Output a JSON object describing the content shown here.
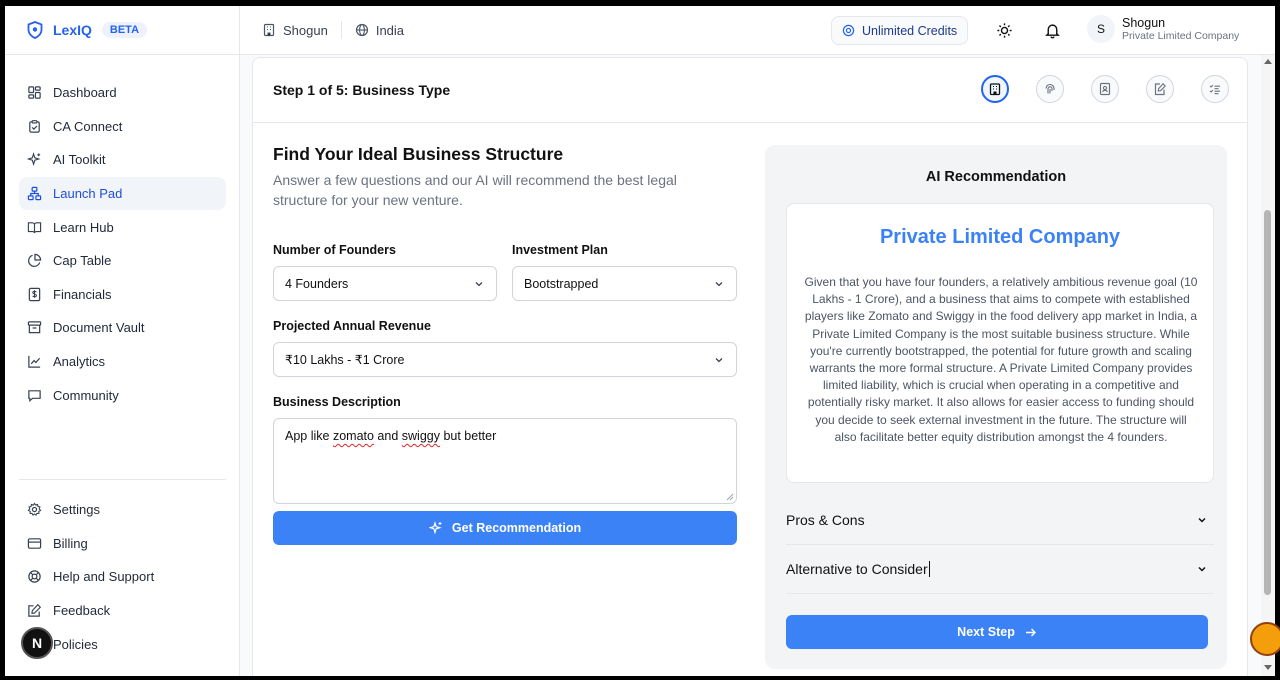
{
  "brand": {
    "name": "LexIQ",
    "badge": "BETA"
  },
  "sidebar": {
    "items": [
      {
        "label": "Dashboard",
        "icon": "dashboard-icon"
      },
      {
        "label": "CA Connect",
        "icon": "clipboard-check-icon"
      },
      {
        "label": "AI Toolkit",
        "icon": "sparkles-icon"
      },
      {
        "label": "Launch Pad",
        "icon": "launch-pad-icon",
        "active": true
      },
      {
        "label": "Learn Hub",
        "icon": "book-open-icon"
      },
      {
        "label": "Cap Table",
        "icon": "pie-chart-icon"
      },
      {
        "label": "Financials",
        "icon": "dollar-file-icon"
      },
      {
        "label": "Document Vault",
        "icon": "archive-icon"
      },
      {
        "label": "Analytics",
        "icon": "line-chart-icon"
      },
      {
        "label": "Community",
        "icon": "chat-icon"
      }
    ],
    "bottom_items": [
      {
        "label": "Settings",
        "icon": "gear-icon"
      },
      {
        "label": "Billing",
        "icon": "credit-card-icon"
      },
      {
        "label": "Help and Support",
        "icon": "lifebuoy-icon"
      },
      {
        "label": "Feedback",
        "icon": "edit-icon"
      },
      {
        "label": "Policies",
        "icon": "shield-icon"
      }
    ],
    "n_badge": "N"
  },
  "topbar": {
    "workspace": "Shogun",
    "region": "India",
    "credits": "Unlimited Credits",
    "user": {
      "initial": "S",
      "name": "Shogun",
      "role": "Private Limited Company"
    }
  },
  "step": {
    "title": "Step 1 of 5: Business Type",
    "icons": [
      "building-icon",
      "fingerprint-icon",
      "id-card-icon",
      "document-edit-icon",
      "checklist-icon"
    ]
  },
  "form": {
    "heading": "Find Your Ideal Business Structure",
    "subheading": "Answer a few questions and our AI will recommend the best legal structure for your new venture.",
    "founders_label": "Number of Founders",
    "founders_value": "4 Founders",
    "investment_label": "Investment Plan",
    "investment_value": "Bootstrapped",
    "revenue_label": "Projected Annual Revenue",
    "revenue_value": "₹10 Lakhs - ₹1 Crore",
    "description_label": "Business Description",
    "description_parts": [
      "App like ",
      "zomato",
      " and ",
      "swiggy",
      " but better"
    ],
    "submit_label": "Get Recommendation"
  },
  "recommendation": {
    "title": "AI Recommendation",
    "structure": "Private Limited Company",
    "text": "Given that you have four founders, a relatively ambitious revenue goal (10 Lakhs - 1 Crore), and a business that aims to compete with established players like Zomato and Swiggy in the food delivery app market in India, a Private Limited Company is the most suitable business structure. While you're currently bootstrapped, the potential for future growth and scaling warrants the more formal structure. A Private Limited Company provides limited liability, which is crucial when operating in a competitive and potentially risky market. It also allows for easier access to funding should you decide to seek external investment in the future. The structure will also facilitate better equity distribution amongst the 4 founders.",
    "pros_cons": "Pros & Cons",
    "alternative": "Alternative to Consider",
    "next": "Next Step"
  },
  "colors": {
    "accent": "#3b82f6",
    "brand": "#2563eb"
  }
}
